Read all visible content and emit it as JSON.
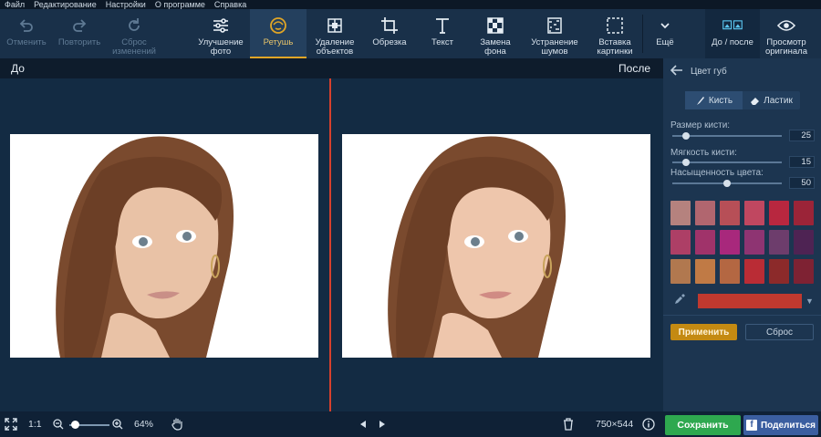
{
  "menu": [
    "Файл",
    "Редактирование",
    "Настройки",
    "О программе",
    "Справка"
  ],
  "toolbar": {
    "undo": "Отменить",
    "redo": "Повторить",
    "reset_changes": "Сброс изменений",
    "enhance": "Улучшение фото",
    "retouch": "Ретушь",
    "remove_objects": "Удаление объектов",
    "crop": "Обрезка",
    "text": "Текст",
    "bg_replace": "Замена фона",
    "denoise": "Устранение шумов",
    "insert_image": "Вставка картинки",
    "more": "Ещё",
    "before_after": "До / после",
    "view_original": "Просмотр оригинала"
  },
  "view": {
    "before_label": "До",
    "after_label": "После"
  },
  "panel": {
    "title": "Цвет губ",
    "brush_tab": "Кисть",
    "eraser_tab": "Ластик",
    "brush_size_label": "Размер кисти:",
    "brush_size": "25",
    "brush_size_fraction": 0.1,
    "softness_label": "Мягкость кисти:",
    "softness": "15",
    "softness_fraction": 0.1,
    "saturation_label": "Насыщенность цвета:",
    "saturation": "50",
    "saturation_fraction": 0.5,
    "swatches": [
      "#b5827e",
      "#b1666f",
      "#b74f57",
      "#c04760",
      "#b8273f",
      "#9b2438",
      "#ad3f66",
      "#a0336a",
      "#a8287c",
      "#8e3472",
      "#6d3d6c",
      "#4e2353",
      "#b1784f",
      "#c07a45",
      "#b46742",
      "#ba2c35",
      "#8c2a2a",
      "#7e2233"
    ],
    "current_color": "#c0392f",
    "apply": "Применить",
    "reset": "Сброс"
  },
  "bottom": {
    "ratio": "1:1",
    "zoom": "64%",
    "zoom_fraction": 0.05,
    "dimensions": "750×544",
    "save": "Сохранить",
    "share": "Поделиться"
  }
}
